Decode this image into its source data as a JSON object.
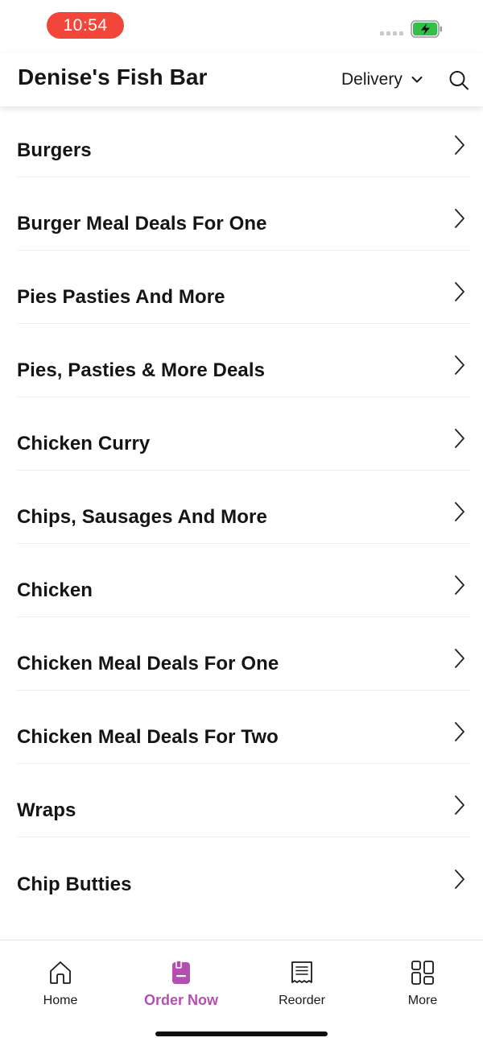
{
  "status_bar": {
    "time": "10:54",
    "time_pill_color": "#f2463b",
    "battery_color": "#31c14b"
  },
  "header": {
    "title": "Denise's Fish Bar",
    "mode_select": "Delivery",
    "search_icon": "search-icon"
  },
  "menu": {
    "items": [
      {
        "label": "Burgers"
      },
      {
        "label": "Burger Meal Deals For One"
      },
      {
        "label": "Pies Pasties And More"
      },
      {
        "label": "Pies, Pasties & More Deals"
      },
      {
        "label": "Chicken Curry"
      },
      {
        "label": "Chips, Sausages And More"
      },
      {
        "label": "Chicken"
      },
      {
        "label": "Chicken Meal Deals For One"
      },
      {
        "label": "Chicken Meal Deals For Two"
      },
      {
        "label": "Wraps"
      },
      {
        "label": "Chip Butties"
      }
    ]
  },
  "tab_bar": {
    "accent_color": "#b150b1",
    "tabs": [
      {
        "label": "Home",
        "icon": "home-icon",
        "active": false
      },
      {
        "label": "Order Now",
        "icon": "order-icon",
        "active": true
      },
      {
        "label": "Reorder",
        "icon": "receipt-icon",
        "active": false
      },
      {
        "label": "More",
        "icon": "grid-icon",
        "active": false
      }
    ]
  }
}
